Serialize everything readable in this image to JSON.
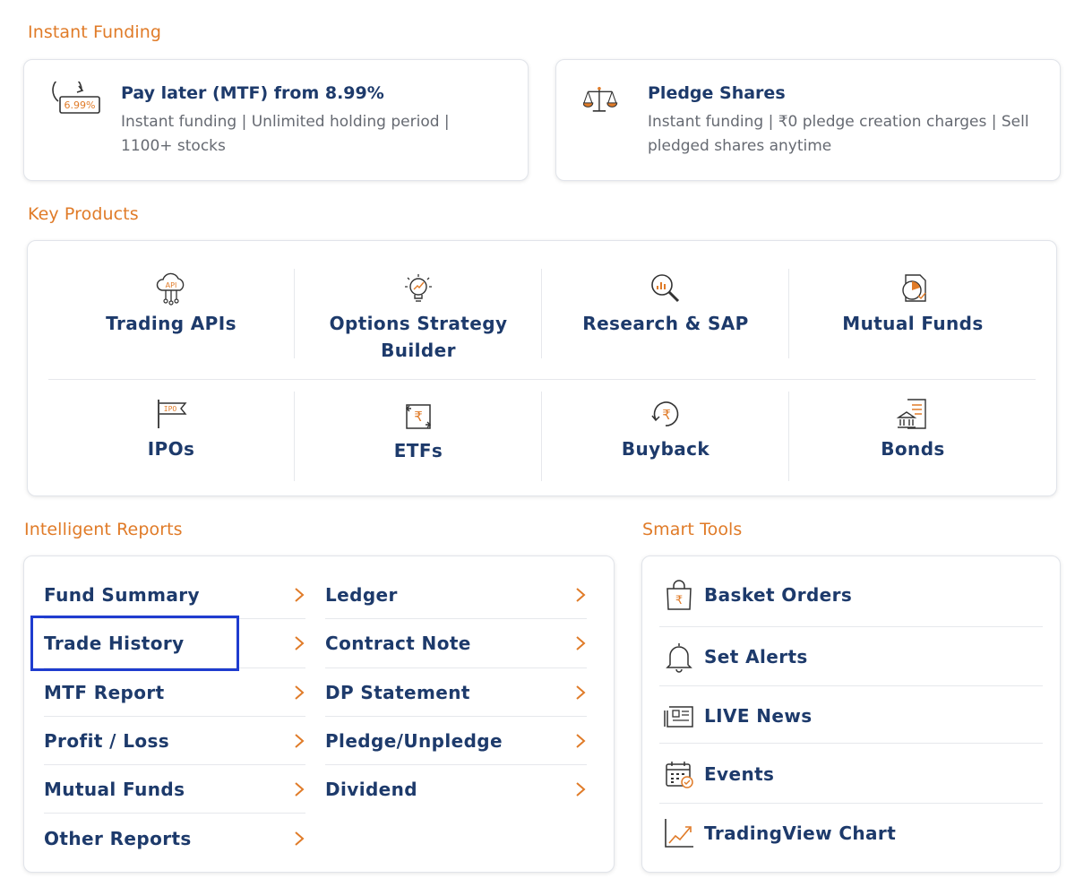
{
  "instant_funding": {
    "title": "Instant Funding",
    "cards": [
      {
        "title": "Pay later (MTF) from 8.99%",
        "desc": "Instant funding | Unlimited holding period | 1100+ stocks",
        "icon": "mtf-badge-icon",
        "badge": "6.99%"
      },
      {
        "title": "Pledge Shares",
        "desc": "Instant funding | ₹0 pledge creation charges | Sell pledged shares anytime",
        "icon": "scales-icon"
      }
    ]
  },
  "key_products": {
    "title": "Key Products",
    "items": [
      {
        "label": "Trading APIs",
        "icon": "api-cloud-icon",
        "icon_text": "API"
      },
      {
        "label": "Options Strategy Builder",
        "icon": "lightbulb-icon"
      },
      {
        "label": "Research & SAP",
        "icon": "magnifier-chart-icon"
      },
      {
        "label": "Mutual Funds",
        "icon": "pie-document-icon"
      },
      {
        "label": "IPOs",
        "icon": "ipo-flag-icon",
        "icon_text": "IPO"
      },
      {
        "label": "ETFs",
        "icon": "rupee-exchange-icon",
        "icon_text": "₹"
      },
      {
        "label": "Buyback",
        "icon": "rupee-cycle-icon",
        "icon_text": "₹"
      },
      {
        "label": "Bonds",
        "icon": "bond-document-icon"
      }
    ]
  },
  "intelligent_reports": {
    "title": "Intelligent Reports",
    "left": [
      "Fund Summary",
      "Trade History",
      "MTF Report",
      "Profit / Loss",
      "Mutual Funds",
      "Other Reports"
    ],
    "right": [
      "Ledger",
      "Contract Note",
      "DP Statement",
      "Pledge/Unpledge",
      "Dividend"
    ]
  },
  "smart_tools": {
    "title": "Smart Tools",
    "items": [
      {
        "label": "Basket Orders",
        "icon": "shopping-bag-icon",
        "icon_text": "₹"
      },
      {
        "label": "Set Alerts",
        "icon": "bell-icon"
      },
      {
        "label": "LIVE News",
        "icon": "newspaper-icon"
      },
      {
        "label": "Events",
        "icon": "calendar-icon"
      },
      {
        "label": "TradingView Chart",
        "icon": "trend-chart-icon"
      }
    ]
  },
  "colors": {
    "accent": "#e07b28",
    "text": "#1d3a6b",
    "highlight": "#1f3ccf"
  }
}
